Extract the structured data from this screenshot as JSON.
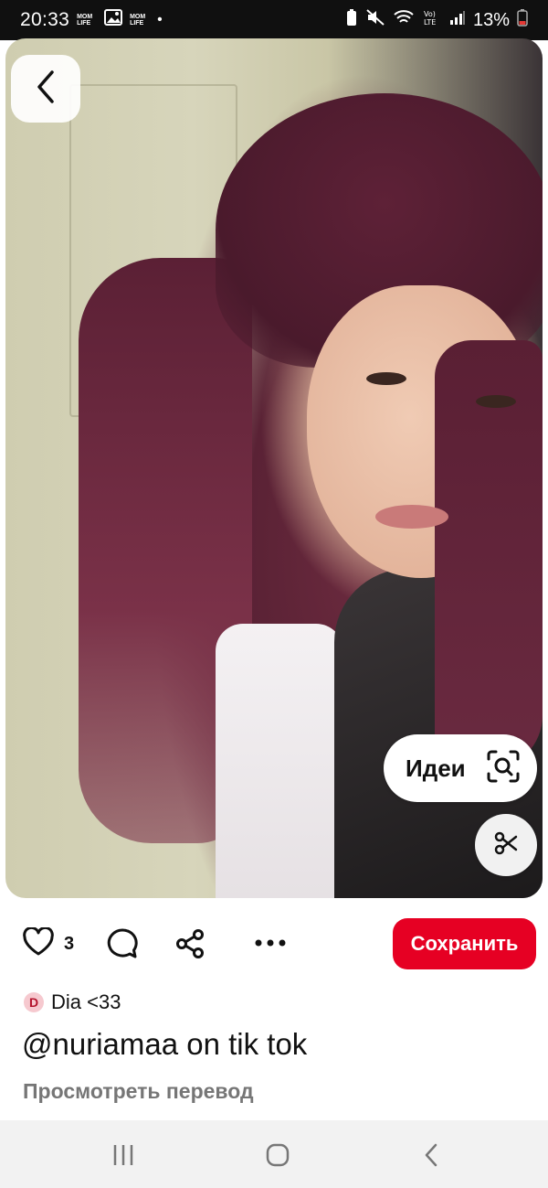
{
  "status_bar": {
    "time": "20:33",
    "notification_badge_1": "MOM LIFE",
    "notification_badge_2": "MOM LIFE",
    "dot": "•",
    "battery": "13%"
  },
  "pin": {
    "ideas_label": "Идеи",
    "likes_count": "3",
    "save_label": "Сохранить",
    "author_initial": "D",
    "author_name": "Dia <33",
    "title": "@nuriamaa on tik tok",
    "translate_label": "Просмотреть перевод"
  },
  "colors": {
    "accent": "#e60023",
    "status_bar_bg": "#101010",
    "nav_bar_bg": "#f2f2f2",
    "secondary_text": "#767676"
  }
}
